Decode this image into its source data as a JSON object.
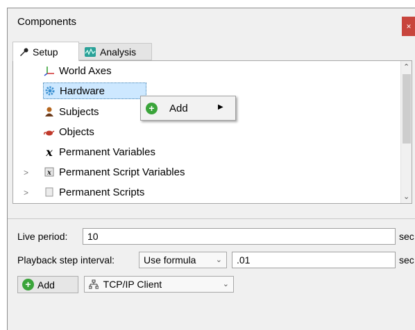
{
  "window": {
    "title": "Components",
    "close_label": "×"
  },
  "tabs": [
    {
      "label": "Setup"
    },
    {
      "label": "Analysis"
    }
  ],
  "tree": {
    "items": [
      {
        "label": "World Axes",
        "icon": "axes-icon"
      },
      {
        "label": "Hardware",
        "icon": "gear-icon",
        "selected": true
      },
      {
        "label": "Subjects",
        "icon": "person-icon"
      },
      {
        "label": "Objects",
        "icon": "teapot-icon"
      },
      {
        "label": "Permanent Variables",
        "icon": "variable-x-icon"
      },
      {
        "label": "Permanent Script Variables",
        "icon": "script-variable-icon"
      },
      {
        "label": "Permanent Scripts",
        "icon": "script-icon"
      }
    ]
  },
  "context_menu": {
    "items": [
      {
        "label": "Add"
      }
    ]
  },
  "live_period": {
    "label": "Live period:",
    "value": "10",
    "unit": "sec"
  },
  "playback": {
    "label": "Playback step interval:",
    "mode": "Use formula",
    "value": ".01",
    "unit": "sec"
  },
  "add_button": {
    "label": "Add"
  },
  "device_select": {
    "value": "TCP/IP Client"
  }
}
